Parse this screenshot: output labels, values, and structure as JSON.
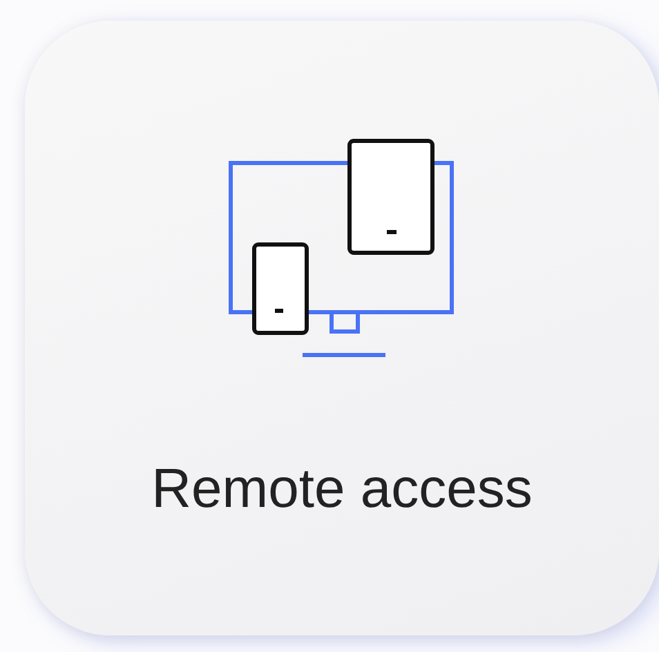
{
  "tile": {
    "label": "Remote access"
  }
}
